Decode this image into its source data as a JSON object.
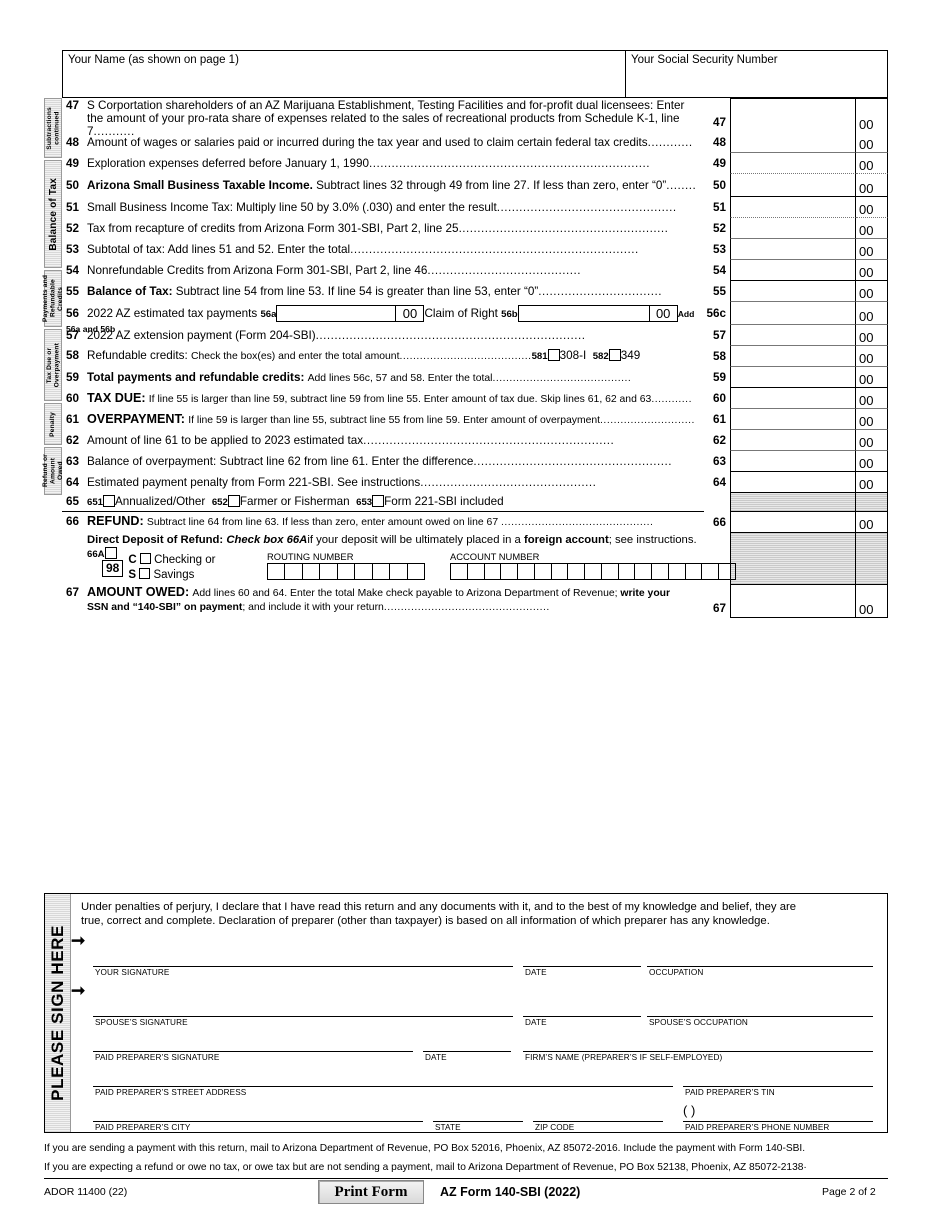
{
  "header": {
    "name_label": "Your Name (as shown on page 1)",
    "ssn_label": "Your Social Security Number"
  },
  "sidebar": [
    {
      "label": "Subtractions\ncontinued",
      "size": "small"
    },
    {
      "label": "Balance of Tax",
      "size": "big"
    },
    {
      "label": "Payments and\nRefundable Credits",
      "size": "small"
    },
    {
      "label": "Tax Due or\nOverpayment",
      "size": "small"
    },
    {
      "label": "Penalty",
      "size": "small"
    },
    {
      "label": "Refund or\nAmount Owed",
      "size": "small"
    }
  ],
  "cents": "00",
  "lines": {
    "l47_num": "47",
    "l47_a": "S Corportation shareholders of an AZ Marijuana Establishment, Testing Facilities and for-profit dual licensees:  Enter",
    "l47_b": "the amount of your pro-rata share of expenses related to the sales of recreational products from Schedule K-1, line 7",
    "l48_num": "48",
    "l48": "Amount of wages or salaries paid or incurred during the tax year and used to claim certain federal tax credits",
    "l49_num": "49",
    "l49": "Exploration expenses deferred before January 1, 1990",
    "l50_num": "50",
    "l50_bold": "Arizona Small Business Taxable Income.",
    "l50_rest": "Subtract lines 32 through 49 from line 27.  If less than zero, enter “0”",
    "l51_num": "51",
    "l51": "Small Business Income Tax:  Multiply line 50 by 3.0% (.030) and enter the result",
    "l52_num": "52",
    "l52": "Tax from recapture of credits from Arizona Form 301-SBI, Part 2, line 25",
    "l53_num": "53",
    "l53": "Subtotal of tax:  Add lines 51 and 52.  Enter the total",
    "l54_num": "54",
    "l54": "Nonrefundable Credits from Arizona Form 301-SBI, Part 2, line 46",
    "l55_num": "55",
    "l55_bold": "Balance of Tax:",
    "l55_rest": "Subtract line 54 from line 53.  If line 54 is greater than line 53, enter “0”",
    "l56_num": "56",
    "l56_text": "2022 AZ estimated tax payments",
    "l56a_tag": "56a",
    "l56b_text": "Claim of Right",
    "l56b_tag": "56b",
    "l56_add": "Add 56a and 56b",
    "l56c_num": "56c",
    "l57_num": "57",
    "l57": "2022 AZ extension payment (Form 204-SBI)",
    "l58_num": "58",
    "l58_bold": "Refundable credits:",
    "l58_rest": "Check the box(es) and enter the total amount",
    "l58_1_tag": "581",
    "l58_1_label": "308-I",
    "l58_2_tag": "582",
    "l58_2_label": "349",
    "l59_num": "59",
    "l59_bold": "Total payments and refundable credits:",
    "l59_rest": "Add lines 56c, 57 and 58.  Enter the total",
    "l60_num": "60",
    "l60_bold": "TAX DUE:",
    "l60_rest": "If line 55 is larger than line 59, subtract line 59 from line 55.  Enter amount of tax due. Skip lines 61, 62 and 63",
    "l61_num": "61",
    "l61_bold": "OVERPAYMENT:",
    "l61_rest": "If line 59 is larger than line 55, subtract line 55 from line 59.  Enter amount of overpayment",
    "l62_num": "62",
    "l62": "Amount of line 61 to be applied to 2023 estimated tax",
    "l63_num": "63",
    "l63": "Balance of overpayment:  Subtract line 62 from line 61.  Enter the difference",
    "l64_num": "64",
    "l64": "Estimated payment penalty from Form 221-SBI.  See instructions",
    "l65_num": "65",
    "l65_1_tag": "651",
    "l65_1_label": "Annualized/Other",
    "l65_2_tag": "652",
    "l65_2_label": "Farmer or Fisherman",
    "l65_3_tag": "653",
    "l65_3_label": "Form 221-SBI included",
    "l66_num": "66",
    "l66_bold": "REFUND:",
    "l66_rest": "Subtract line 64 from line 63.  If less than zero, enter amount owed on line 67 ",
    "l66_dd_bold": "Direct Deposit of Refund:",
    "l66_dd_italic": "Check box 66A",
    "l66_dd_mid": "if your deposit will be ultimately placed in a ",
    "l66_dd_bold2": "foreign account",
    "l66_dd_end": "; see instructions.",
    "l66a_tag": "66A",
    "dd_98": "98",
    "dd_c": "C",
    "dd_checking": "Checking or",
    "dd_s": "S",
    "dd_savings": "Savings",
    "routing_label": "ROUTING NUMBER",
    "routing_cells": 9,
    "account_label": "ACCOUNT NUMBER",
    "account_cells": 17,
    "l67_num": "67",
    "l67_bold": "AMOUNT OWED:",
    "l67_rest": "Add lines 60 and 64.  Enter the total     Make check payable to Arizona Department of Revenue; ",
    "l67_bold2": "write your",
    "l67_b_bold": "SSN and “140-SBI” on payment",
    "l67_b_rest": "; and include it with your return"
  },
  "signature": {
    "tab_label": "PLEASE SIGN HERE",
    "perjury_1": "Under penalties of perjury, I declare that I have read this return and any documents with it, and to the best of my knowledge and belief, they are",
    "perjury_2": "true, correct and complete.  Declaration of preparer (other than taxpayer) is based on all information of which preparer has any knowledge.",
    "your_signature": "YOUR SIGNATURE",
    "date_1": "DATE",
    "occupation": "OCCUPATION",
    "spouse_signature": "SPOUSE’S SIGNATURE",
    "date_2": "DATE",
    "spouse_occupation": "SPOUSE’S OCCUPATION",
    "preparer_signature": "PAID PREPARER’S SIGNATURE",
    "date_3": "DATE",
    "firm_name": "FIRM’S NAME (PREPARER’S IF SELF-EMPLOYED)",
    "preparer_address": "PAID PREPARER’S STREET ADDRESS",
    "preparer_tin": "PAID PREPARER’S TIN",
    "preparer_city": "PAID PREPARER’S CITY",
    "state": "STATE",
    "zip": "ZIP CODE",
    "preparer_phone": "PAID PREPARER’S PHONE NUMBER",
    "phone_parens": "(            )"
  },
  "footer": {
    "mail_1": "If you are sending a payment with this return, mail to Arizona Department of Revenue, PO Box 52016, Phoenix, AZ  85072-2016.  Include the payment with Form 140-SBI.",
    "mail_2": "If you are expecting a refund or owe no tax, or owe tax but are not sending a payment, mail to Arizona Department of Revenue, PO Box 52138, Phoenix, AZ  85072-2138·",
    "ador": "ADOR 11400 (22)",
    "print_button": "Print Form",
    "form_title": "AZ Form 140-SBI (2022)",
    "page": "Page 2 of 2"
  }
}
